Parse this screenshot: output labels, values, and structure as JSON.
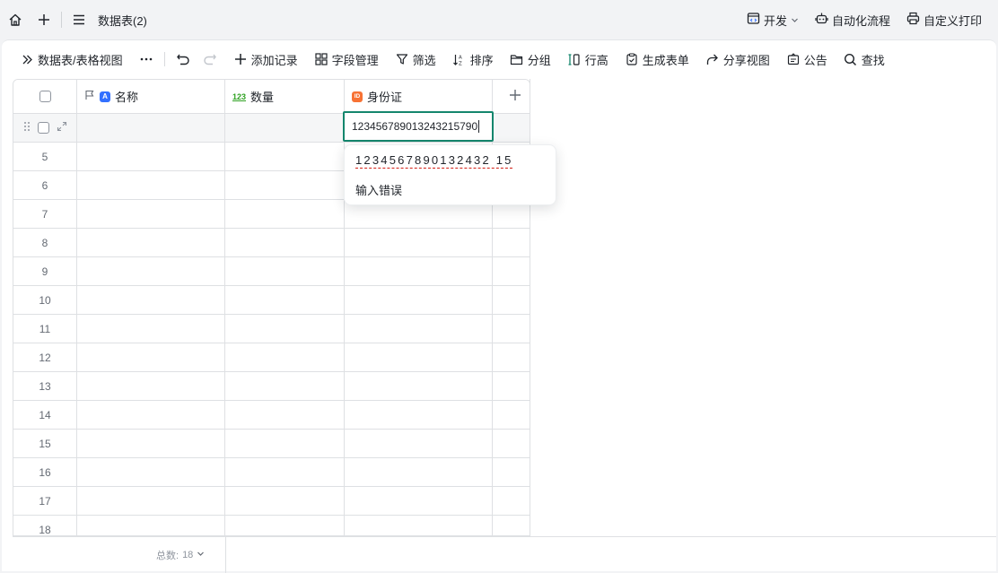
{
  "topbar": {
    "title": "数据表(2)",
    "dev_label": "开发",
    "automation_label": "自动化流程",
    "print_label": "自定义打印"
  },
  "toolbar": {
    "view_label": "数据表/表格视图",
    "add_record": "添加记录",
    "fields": "字段管理",
    "filter": "筛选",
    "sort": "排序",
    "group": "分组",
    "row_height": "行高",
    "form": "生成表单",
    "share": "分享视图",
    "notice": "公告",
    "find": "查找"
  },
  "table": {
    "columns": [
      {
        "name": "名称",
        "type": "text",
        "badge": "A",
        "badge_color": "#3370ff"
      },
      {
        "name": "数量",
        "type": "number",
        "badge": "123",
        "badge_color": "#2ea121"
      },
      {
        "name": "身份证",
        "type": "id",
        "badge": "ID",
        "badge_color": "#f77234"
      }
    ],
    "rows": [
      "5",
      "6",
      "7",
      "8",
      "9",
      "10",
      "11",
      "12",
      "13",
      "14",
      "15",
      "16",
      "17",
      "18"
    ]
  },
  "editor": {
    "value": "1234567890132432157​90"
  },
  "popup": {
    "digits": "1234567890132432 15",
    "error": "输入错误"
  },
  "footer": {
    "count_label": "总数:",
    "count_value": "18"
  }
}
